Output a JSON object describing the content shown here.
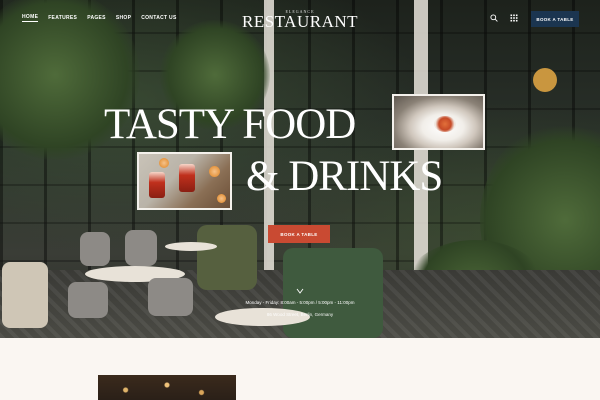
{
  "nav": {
    "items": [
      {
        "label": "HOME",
        "active": true
      },
      {
        "label": "FEATURES",
        "active": false
      },
      {
        "label": "PAGES",
        "active": false
      },
      {
        "label": "SHOP",
        "active": false
      },
      {
        "label": "CONTACT US",
        "active": false
      }
    ]
  },
  "logo": {
    "subtitle": "ELEGANCE",
    "title": "RESTAURANT"
  },
  "header": {
    "icons": [
      "search-icon",
      "grid-menu-icon"
    ],
    "book_button": "BOOK A TABLE"
  },
  "hero": {
    "title_line_1": "TASTY FOOD",
    "title_line_2": "& DRINKS",
    "book_button": "BOOK A TABLE",
    "hours": "Monday - Friday: 8:00am - 5:00pm / 5:00pm - 11:00pm",
    "address": "86 Wood Street, Berlin, Germany"
  },
  "colors": {
    "header_button": "#1b3550",
    "hero_button": "#c94a32",
    "text": "#ffffff",
    "page_background": "#faf6f2"
  }
}
